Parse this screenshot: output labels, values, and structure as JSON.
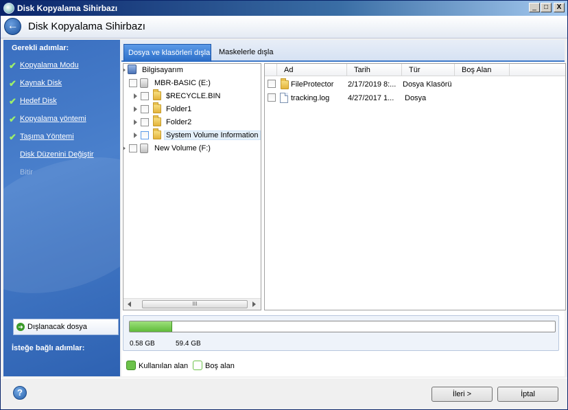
{
  "window": {
    "title": "Disk Kopyalama Sihirbazı",
    "controls": [
      "_",
      "□",
      "X"
    ]
  },
  "header": {
    "title": "Disk Kopyalama Sihirbazı"
  },
  "sidebar": {
    "required_heading": "Gerekli adımlar:",
    "steps": [
      {
        "label": "Kopyalama Modu",
        "done": true
      },
      {
        "label": "Kaynak Disk",
        "done": true
      },
      {
        "label": "Hedef Disk",
        "done": true
      },
      {
        "label": "Kopyalama yöntemi",
        "done": true
      },
      {
        "label": "Taşıma Yöntemi",
        "done": true
      },
      {
        "label": "Disk Düzenini Değiştir",
        "done": false
      },
      {
        "label": "Bitir",
        "done": false,
        "disabled": true
      }
    ],
    "optional_heading": "İsteğe bağlı adımlar:",
    "optional_item": "Dışlanacak dosya"
  },
  "tabs": {
    "active": "Dosya ve klasörleri dışla",
    "inactive": "Maskelerle dışla"
  },
  "tree": {
    "items": [
      {
        "label": "Bilgisayarım",
        "level": 0
      },
      {
        "label": "MBR-BASIC (E:)",
        "level": 1
      },
      {
        "label": "$RECYCLE.BIN",
        "level": 2
      },
      {
        "label": "Folder1",
        "level": 2
      },
      {
        "label": "Folder2",
        "level": 2
      },
      {
        "label": "System Volume Information",
        "level": 2,
        "selected": true
      },
      {
        "label": "New Volume (F:)",
        "level": 1
      }
    ],
    "scroll_grip": "III"
  },
  "list": {
    "columns": [
      "Ad",
      "Tarih",
      "Tür",
      "Boş Alan"
    ],
    "rows": [
      {
        "name": "FileProtector",
        "date": "2/17/2019 8:...",
        "type": "Dosya Klasörü",
        "free": "",
        "icon": "folder-icon"
      },
      {
        "name": "tracking.log",
        "date": "4/27/2017 1...",
        "type": "Dosya",
        "free": "",
        "icon": "file-icon"
      }
    ]
  },
  "usage": {
    "used": "0.58 GB",
    "free": "59.4 GB",
    "fill_fraction": 0.1,
    "used_color": "#6cc24a",
    "free_color": "#ffffff"
  },
  "legend": {
    "used": "Kullanılan alan",
    "free": "Boş alan"
  },
  "buttons": {
    "next": "İleri >",
    "cancel": "İptal",
    "help": "?"
  }
}
